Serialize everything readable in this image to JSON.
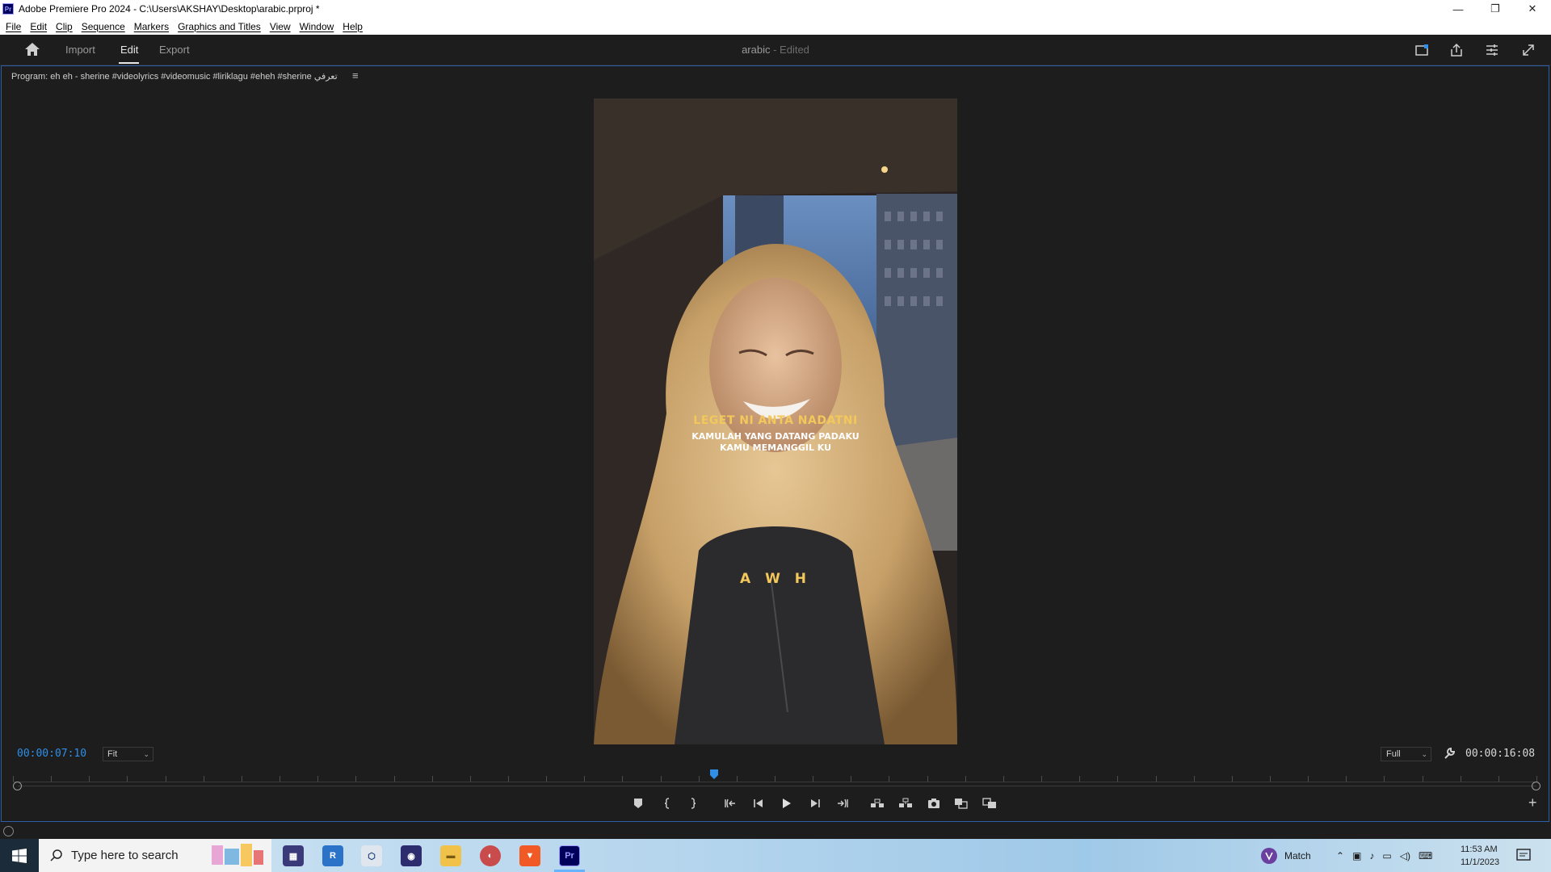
{
  "window": {
    "app_icon_text": "Pr",
    "title": "Adobe Premiere Pro 2024 - C:\\Users\\AKSHAY\\Desktop\\arabic.prproj *",
    "minimize": "—",
    "restore": "❐",
    "close": "✕"
  },
  "menu": [
    "File",
    "Edit",
    "Clip",
    "Sequence",
    "Markers",
    "Graphics and Titles",
    "View",
    "Window",
    "Help"
  ],
  "header": {
    "tabs": [
      "Import",
      "Edit",
      "Export"
    ],
    "active_tab": "Edit",
    "project_name": "arabic",
    "project_status": "- Edited"
  },
  "program_monitor": {
    "title": "Program: eh eh - sherine #videolyrics #videomusic #liriklagu #eheh #sherine تعرفي",
    "menu_icon": "≡",
    "current_timecode": "00:00:07:10",
    "zoom": "Fit",
    "resolution": "Full",
    "duration_timecode": "00:00:16:08",
    "playhead_position": 0.46,
    "captions": {
      "line1": "LEGET NI ANTA NADATNI",
      "line2": "KAMULAH YANG DATANG PADAKU",
      "line3": "KAMU MEMANGGIL KU",
      "line4": "A W H"
    },
    "add_button": "+"
  },
  "taskbar": {
    "search_placeholder": "Type here to search",
    "apps": [
      "winrar-icon",
      "r-studio-icon",
      "virtualbox-icon",
      "obs-icon",
      "file-explorer-icon",
      "chrome-canary-icon",
      "brave-icon",
      "premiere-icon"
    ],
    "premiere_label": "Pr",
    "weather_label": "Match",
    "time": "11:53 AM",
    "date": "11/1/2023"
  },
  "colors": {
    "accent_blue": "#2f8fe8",
    "caption_yellow": "#f2c85b",
    "panel_border": "#2d5fa8"
  }
}
